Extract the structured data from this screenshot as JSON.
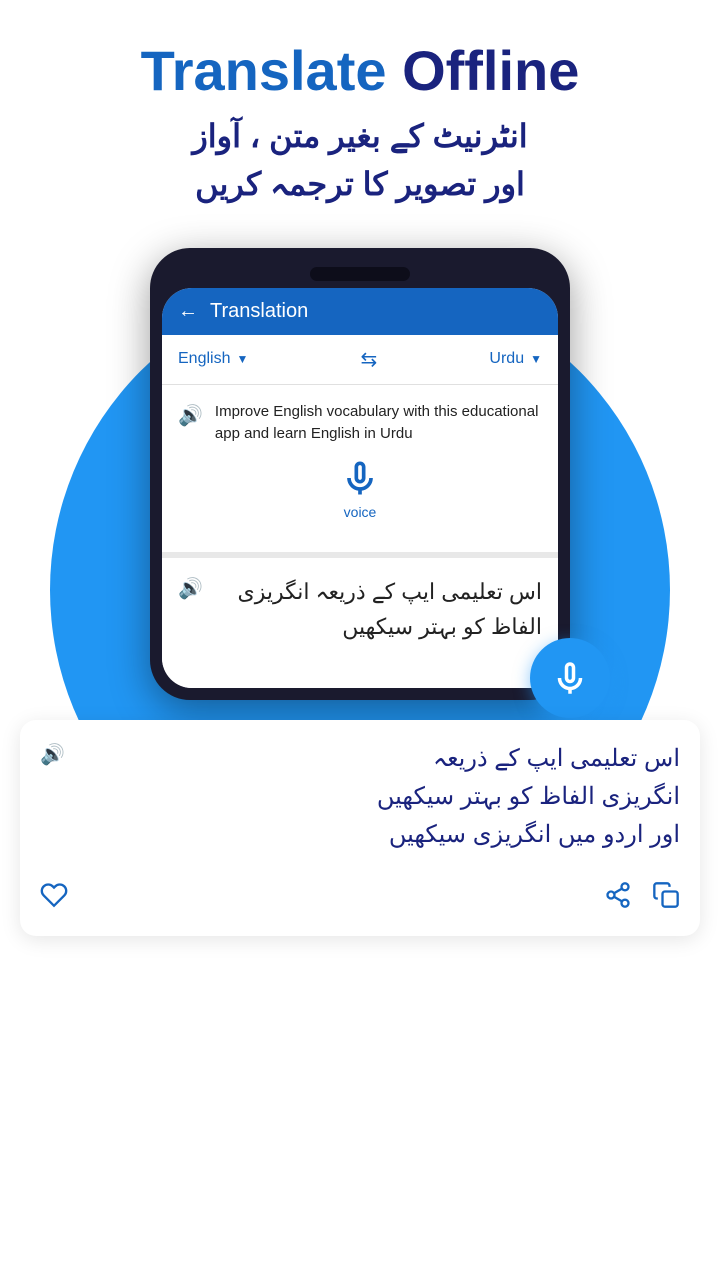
{
  "header": {
    "title_translate": "Translate",
    "title_offline": "Offline",
    "subtitle_urdu_line1": "انٹرنیٹ کے بغیر متن ، آواز",
    "subtitle_urdu_line2": "اور تصویر کا ترجمہ کریں"
  },
  "app": {
    "back_icon": "←",
    "title": "Translation"
  },
  "language_bar": {
    "source_lang": "English",
    "source_dropdown": "▼",
    "swap_icon": "⇆",
    "target_lang": "Urdu",
    "target_dropdown": "▼"
  },
  "input_section": {
    "speaker_icon": "🔊",
    "text": "Improve English vocabulary with this educational app and learn English in Urdu",
    "voice_label": "voice"
  },
  "output_section": {
    "speaker_icon": "🔊",
    "text_urdu": "اس تعلیمی ایپ کے ذریعہ انگریزی الفاظ کو بہتر سیکھیں"
  },
  "bottom_card": {
    "speaker_icon": "🔊",
    "text_urdu_line1": "اس تعلیمی ایپ کے ذریعہ",
    "text_urdu_line2": "انگریزی الفاظ کو بہتر سیکھیں",
    "text_urdu_line3": "اور اردو میں انگریزی سیکھیں",
    "favorite_icon": "♡",
    "share_icon": "share",
    "copy_icon": "copy"
  },
  "colors": {
    "primary": "#1565C0",
    "accent": "#2196F3",
    "dark_blue": "#1a237e",
    "text_dark": "#222222",
    "bg_light": "#f5f5f5"
  }
}
